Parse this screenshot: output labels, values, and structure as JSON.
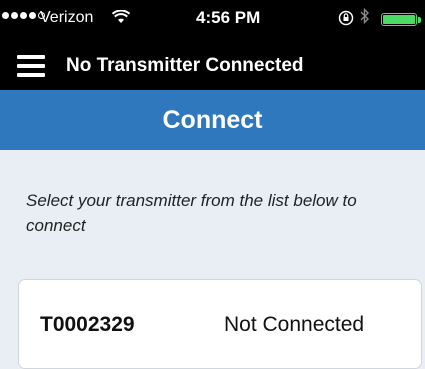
{
  "status_bar": {
    "carrier": "Verizon",
    "time": "4:56 PM",
    "signal_bars_filled": 4,
    "signal_bars_total": 5,
    "icons": [
      "wifi-icon",
      "orientation-lock-icon",
      "bluetooth-icon",
      "battery-icon"
    ]
  },
  "nav": {
    "title": "No Transmitter Connected",
    "menu_icon": "hamburger-menu-icon"
  },
  "header": {
    "title": "Connect"
  },
  "main": {
    "instruction": "Select your transmitter from the list below to connect",
    "transmitters": [
      {
        "id": "T0002329",
        "status": "Not Connected"
      }
    ]
  },
  "colors": {
    "header_blue": "#2f78bd",
    "background": "#e8eef4",
    "battery_green": "#4cd964"
  }
}
